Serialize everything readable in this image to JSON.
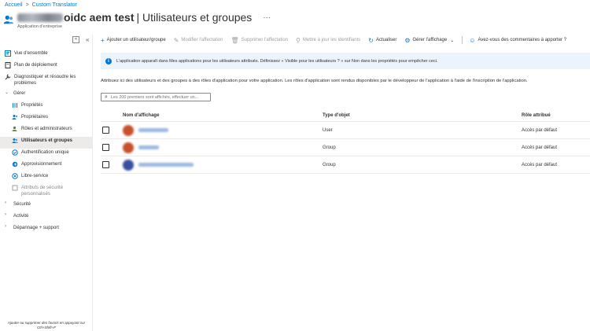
{
  "breadcrumb": {
    "home": "Accueil",
    "separator": ">",
    "current": "Custom Translator"
  },
  "header": {
    "title_bold": "oidc aem test",
    "title_rest": "| Utilisateurs et groupes",
    "subtitle": "Application d'entreprise",
    "more": "···"
  },
  "sidebar": {
    "collapse_box": "«",
    "collapse_chev": "«",
    "items": [
      {
        "label": "Vue d'ensemble",
        "icon": "overview-icon"
      },
      {
        "label": "Plan de déploiement",
        "icon": "book-icon"
      },
      {
        "label": "Diagnostiquer et résoudre les problèmes",
        "icon": "wrench-icon"
      },
      {
        "label": "Gérer",
        "icon": "chevron-down-icon"
      },
      {
        "label": "Propriétés",
        "icon": "properties-icon"
      },
      {
        "label": "Propriétaires",
        "icon": "owners-icon"
      },
      {
        "label": "Rôles et administrateurs",
        "icon": "roles-icon"
      },
      {
        "label": "Utilisateurs et groupes",
        "icon": "users-groups-icon"
      },
      {
        "label": "Authentification unique",
        "icon": "sso-icon"
      },
      {
        "label": "Approvisionnement",
        "icon": "provisioning-icon"
      },
      {
        "label": "Libre-service",
        "icon": "self-service-icon"
      },
      {
        "label": "Attributs de sécurité personnalisés",
        "icon": "security-attributes-icon"
      },
      {
        "label": "Sécurité",
        "icon": "chevron-right-icon"
      },
      {
        "label": "Activité",
        "icon": "chevron-right-icon"
      },
      {
        "label": "Dépannage + support",
        "icon": "chevron-right-icon"
      }
    ],
    "footer": "Ajouter ou supprimer des favoris en appuyant sur Ctrl+Shift+F"
  },
  "toolbar": {
    "add": "Ajouter un utilisateur/groupe",
    "edit": "Modifier l'affectation",
    "delete": "Supprimer l'affectation",
    "update": "Mettre à jour les identifiants",
    "refresh": "Actualiser",
    "view": "Gérer l'affichage",
    "feedback": "Avez-vous des commentaires à apporter ?"
  },
  "info": {
    "icon": "i",
    "text": "L'application apparaît dans Mes applications pour les utilisateurs attribués. Définissez « Visible pour les utilisateurs ? » sur Non dans les propriétés pour empêcher ceci."
  },
  "description": "Attribuez ici des utilisateurs et des groupes à des rôles d'application pour votre application. Les rôles d'application sont rendus disponibles par le développeur de l'application à l'aide de l'inscription de l'application.",
  "search": {
    "placeholder": "Les 200 premiers sont affichés, effectuer un..."
  },
  "table": {
    "headers": {
      "name": "Nom d'affichage",
      "type": "Type d'objet",
      "role": "Rôle attribué"
    },
    "rows": [
      {
        "type": "User",
        "role": "Accès par défaut",
        "avatar_color": "#c8502e"
      },
      {
        "type": "Group",
        "role": "Accès par défaut",
        "avatar_color": "#c8502e"
      },
      {
        "type": "Group",
        "role": "Accès par défaut",
        "avatar_color": "#3a4fa0"
      }
    ]
  },
  "colors": {
    "accent": "#0078d4",
    "info_bg": "#ebf3fc",
    "active_nav": "#edebe9"
  }
}
